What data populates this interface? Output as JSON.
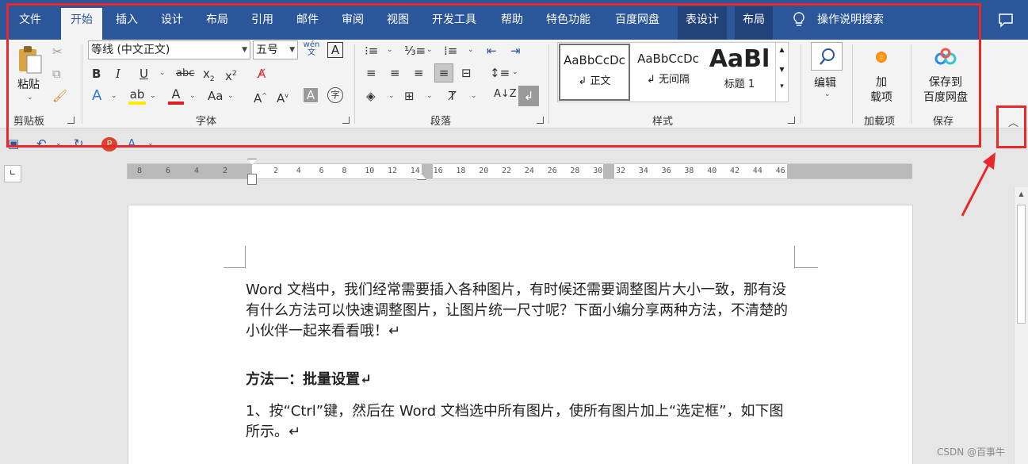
{
  "tabs": [
    "文件",
    "开始",
    "插入",
    "设计",
    "布局",
    "引用",
    "邮件",
    "审阅",
    "视图",
    "开发工具",
    "帮助",
    "特色功能",
    "百度网盘",
    "表设计",
    "布局"
  ],
  "tell_me": "操作说明搜索",
  "clipboard": {
    "paste": "粘贴",
    "group": "剪贴板"
  },
  "font": {
    "name": "等线 (中文正文)",
    "size": "五号",
    "group": "字体",
    "wen": "wén 文"
  },
  "paragraph": {
    "group": "段落"
  },
  "styles": {
    "group": "样式",
    "items": [
      {
        "preview": "AaBbCcDc",
        "label": "↲ 正文"
      },
      {
        "preview": "AaBbCcDc",
        "label": "↲ 无间隔"
      },
      {
        "preview": "AaBl",
        "label": "标题 1"
      }
    ]
  },
  "editing": {
    "label": "编辑"
  },
  "addins": {
    "label": "加\n载项",
    "group": "加载项"
  },
  "save_baidu": {
    "label": "保存到\n百度网盘",
    "group": "保存"
  },
  "ruler_left": [
    "8",
    "6",
    "4",
    "2"
  ],
  "ruler_right": [
    "2",
    "4",
    "6",
    "8",
    "10",
    "12",
    "14",
    "16",
    "18",
    "20",
    "22",
    "24",
    "26",
    "28",
    "30",
    "32",
    "34",
    "36",
    "38",
    "40",
    "42",
    "44",
    "46"
  ],
  "document": {
    "p1": "Word 文档中，我们经常需要插入各种图片，有时候还需要调整图片大小一致，那有没有什么方法可以快速调整图片，让图片统一尺寸呢？下面小编分享两种方法，不清楚的小伙伴一起来看看哦！↵",
    "heading": "方法一：批量设置↵",
    "p2": "1、按“Ctrl”键，然后在 Word 文档选中所有图片，使所有图片加上“选定框”，如下图所示。↵"
  },
  "watermark": "CSDN @百事牛",
  "colors": {
    "tabbar": "#2b579a",
    "ribbon": "#f3f3f3",
    "highlight": "#e8282b"
  }
}
